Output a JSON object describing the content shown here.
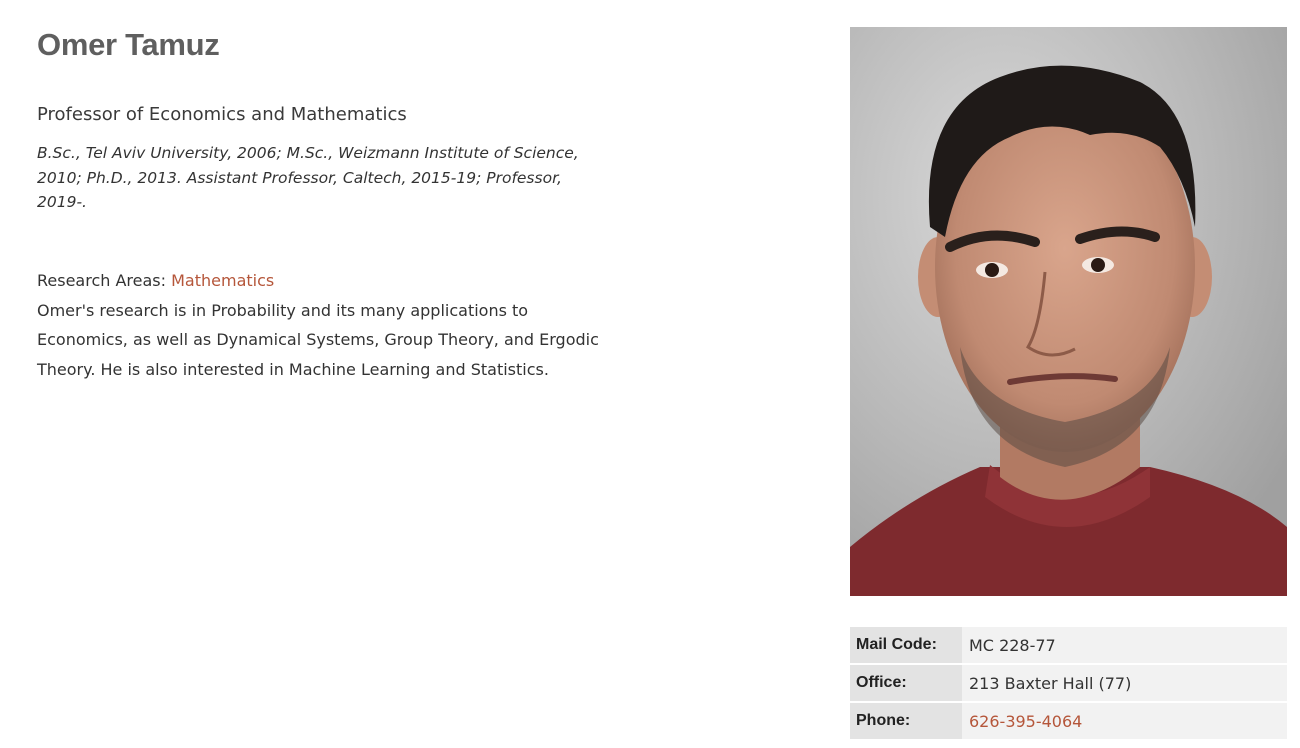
{
  "profile": {
    "name": "Omer Tamuz",
    "title": "Professor of Economics and Mathematics",
    "bio": "B.Sc., Tel Aviv University, 2006; M.Sc., Weizmann Institute of Science, 2010; Ph.D., 2013. Assistant Professor, Caltech, 2015-19; Professor, 2019-.",
    "research_areas_label": "Research Areas:",
    "research_area_link": "Mathematics",
    "research_description": "Omer's research is in Probability and its many applications to Economics, as well as Dynamical Systems, Group Theory, and Ergodic Theory. He is also interested in Machine Learning and Statistics.",
    "photo_icon": "portrait-photo"
  },
  "contact": {
    "mail_code_label": "Mail Code:",
    "mail_code_value": "MC 228-77",
    "office_label": "Office:",
    "office_value": "213 Baxter Hall (77)",
    "phone_label": "Phone:",
    "phone_value": "626-395-4064"
  },
  "colors": {
    "link_accent": "#b5563a",
    "name_gray": "#5f5f5f",
    "label_cell_bg": "#e3e3e3",
    "value_cell_bg": "#f2f2f2"
  }
}
